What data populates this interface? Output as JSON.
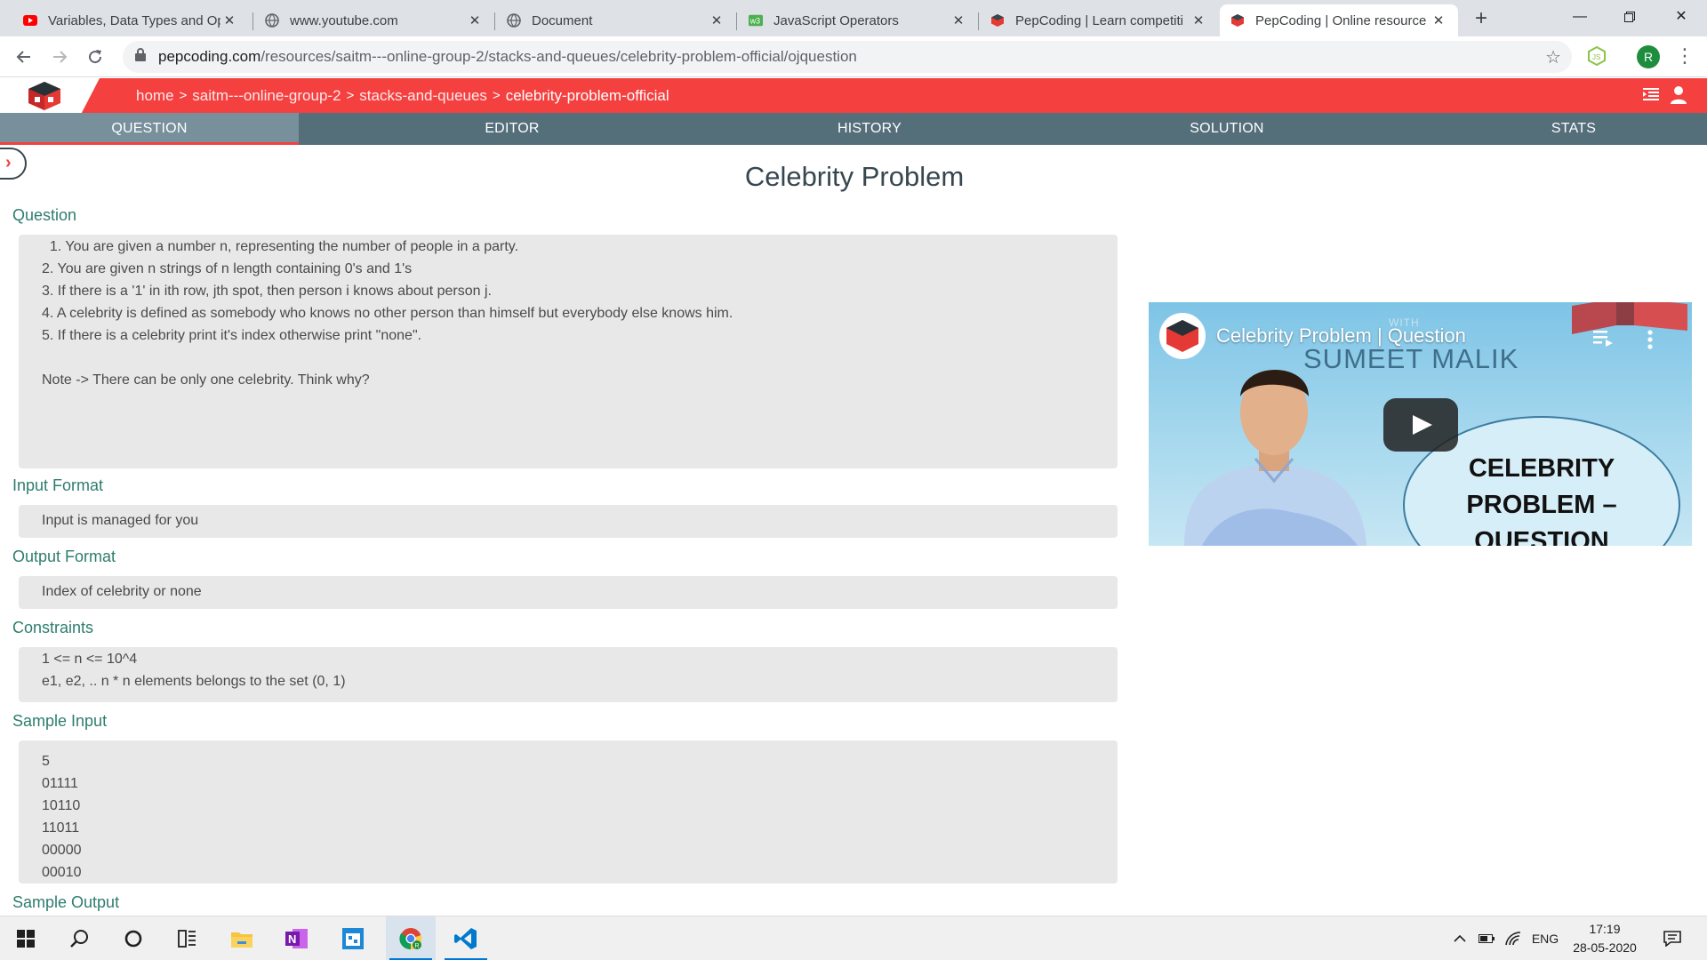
{
  "browser": {
    "tabs": [
      {
        "title": "Variables, Data Types and Op",
        "favicon": "youtube-icon",
        "active": false
      },
      {
        "title": "www.youtube.com",
        "favicon": "globe-icon",
        "active": false
      },
      {
        "title": "Document",
        "favicon": "globe-icon",
        "active": false
      },
      {
        "title": "JavaScript Operators",
        "favicon": "w3schools-icon",
        "active": false
      },
      {
        "title": "PepCoding | Learn competiti",
        "favicon": "pepcoding-icon",
        "active": false
      },
      {
        "title": "PepCoding | Online resource",
        "favicon": "pepcoding-icon",
        "active": true
      }
    ],
    "url_domain": "pepcoding.com",
    "url_path": "/resources/saitm---online-group-2/stacks-and-queues/celebrity-problem-official/ojquestion",
    "profile_initial": "R",
    "colors": {
      "tabstrip": "#dee1e6",
      "profile": "#1e8e3e"
    }
  },
  "site": {
    "breadcrumb": [
      "home",
      "saitm---online-group-2",
      "stacks-and-queues",
      "celebrity-problem-official"
    ],
    "tabs": [
      "QUESTION",
      "EDITOR",
      "HISTORY",
      "SOLUTION",
      "STATS"
    ],
    "active_tab": "QUESTION",
    "colors": {
      "header": "#f54040",
      "tabbar": "#546e7a",
      "active_tab": "#78909c",
      "section_label": "#2e7d6e"
    }
  },
  "problem": {
    "title": "Celebrity Problem",
    "question_label": "Question",
    "question_lines": [
      "  1. You are given a number n, representing the number of people in a party.",
      "2. You are given n strings of n length containing 0's and 1's",
      "3. If there is a '1' in ith row, jth spot, then person i knows about person j.",
      "4. A celebrity is defined as somebody who knows no other person than himself but everybody else knows him.",
      "5. If there is a celebrity print it's index otherwise print \"none\".",
      "",
      "Note -> There can be only one celebrity. Think why?"
    ],
    "input_format_label": "Input Format",
    "input_format": "Input is managed for you",
    "output_format_label": "Output Format",
    "output_format": "Index of celebrity or none",
    "constraints_label": "Constraints",
    "constraints_lines": [
      "1 <= n <= 10^4",
      "e1, e2, .. n * n elements belongs to the set (0, 1)"
    ],
    "sample_input_label": "Sample Input",
    "sample_input_lines": [
      "5",
      "01111",
      "10110",
      "11011",
      "00000",
      "00010"
    ],
    "sample_output_label": "Sample Output"
  },
  "video": {
    "title": "Celebrity Problem | Question",
    "with_text": "WITH",
    "presenter": "SUMEET MALIK",
    "caption_lines": [
      "CELEBRITY",
      "PROBLEM –",
      "QUESTION"
    ]
  },
  "taskbar": {
    "apps": [
      "start-icon",
      "search-icon",
      "cortana-icon",
      "task-view-icon",
      "file-explorer-icon",
      "onenote-icon",
      "calendar-icon",
      "chrome-icon",
      "vscode-icon"
    ],
    "language": "ENG",
    "time": "17:19",
    "date": "28-05-2020"
  }
}
